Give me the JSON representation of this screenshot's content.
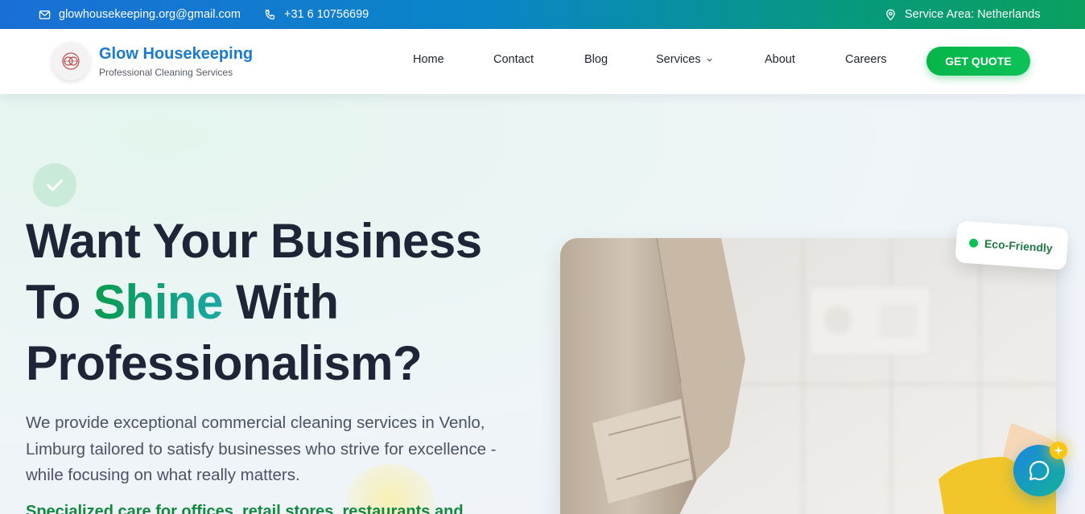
{
  "topbar": {
    "email": "glowhousekeeping.org@gmail.com",
    "phone": "+31 6 10756699",
    "service_area": "Service Area: Netherlands",
    "icons": [
      "mail-icon",
      "phone-icon",
      "location-pin-icon"
    ]
  },
  "header": {
    "brand_name": "Glow Housekeeping",
    "brand_tagline": "Professional Cleaning Services",
    "nav": [
      {
        "label": "Home"
      },
      {
        "label": "Contact"
      },
      {
        "label": "Blog"
      },
      {
        "label": "Services",
        "has_dropdown": true
      },
      {
        "label": "About"
      },
      {
        "label": "Careers"
      }
    ],
    "cta_label": "GET QUOTE"
  },
  "hero": {
    "title_line1": "Want Your Business",
    "title_line2_pre": "To ",
    "title_line2_highlight": "Shine",
    "title_line2_post": " With",
    "title_line3": "Professionalism?",
    "lead": "We provide exceptional commercial cleaning services in Venlo, Limburg tailored to satisfy businesses who strive for excellence - while focusing on what really matters.",
    "sub": "Specialized care for offices, retail stores, restaurants and",
    "badge_label": "Eco-Friendly"
  },
  "colors": {
    "brand_blue": "#1a7ad0",
    "accent_green": "#06b54a",
    "heading": "#1d2536",
    "text": "#4a5363"
  }
}
